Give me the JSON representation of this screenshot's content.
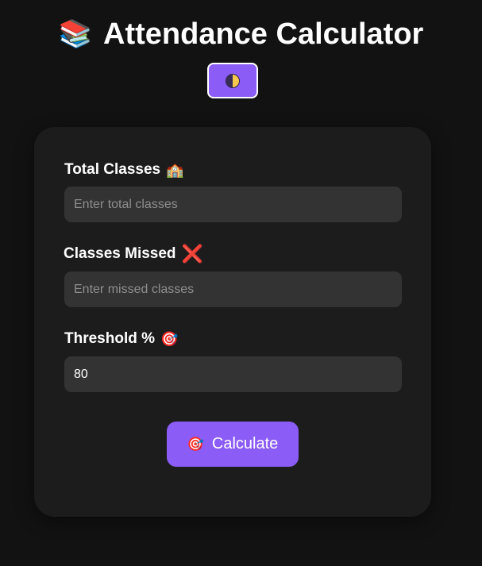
{
  "header": {
    "title": "Attendance Calculator",
    "title_icon": "📚",
    "title_icon_name": "books-icon"
  },
  "theme_toggle": {
    "icon_name": "half-moon-icon"
  },
  "form": {
    "total_classes": {
      "label": "Total Classes",
      "emoji": "🏫",
      "placeholder": "Enter total classes",
      "value": ""
    },
    "classes_missed": {
      "label": "Classes Missed",
      "emoji": "❌",
      "placeholder": "Enter missed classes",
      "value": ""
    },
    "threshold": {
      "label": "Threshold %",
      "emoji": "🎯",
      "placeholder": "",
      "value": "80"
    },
    "calculate_button": {
      "icon": "🎯",
      "label": "Calculate"
    }
  },
  "colors": {
    "accent": "#8b5cf6",
    "background": "#121212",
    "card": "#1c1c1c",
    "input": "#333333"
  }
}
